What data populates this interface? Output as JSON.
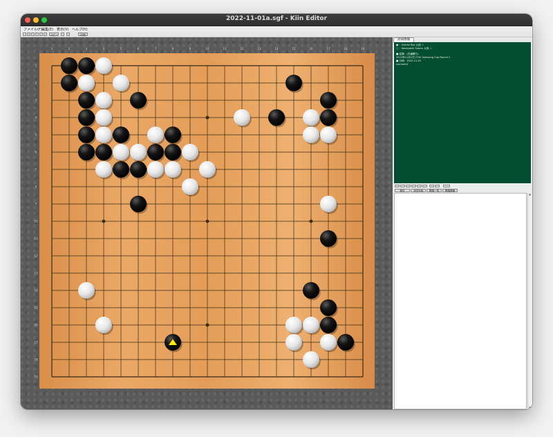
{
  "window": {
    "title": "2022-11-01a.sgf - Kiin Editor"
  },
  "menu": {
    "items": [
      "ファイル(F)",
      "編集(E)",
      "表示(V)",
      "ヘルプ(H)"
    ]
  },
  "toolbar": {
    "labels": [
      "コピー",
      "印刷"
    ]
  },
  "sidepanel": {
    "tab_label": "対局情報",
    "info_rows": [
      "● ：Ichiriki Ryo                 九段 ☆",
      "○ ：Kobayashi Satoru            九段 ☆",
      "■ 結果：(白番勝ち)",
      "2022年11月1日 27th Samsung Cup Round 1",
      "■ 日時：2022-11-01",
      "comment"
    ],
    "nav_buttons": [
      "検討",
      "次回対局",
      "棋譜一覧",
      "棋譜情報"
    ]
  },
  "board": {
    "size": 19,
    "col_labels": [
      "1",
      "2",
      "3",
      "4",
      "5",
      "6",
      "7",
      "8",
      "9",
      "10",
      "11",
      "12",
      "13",
      "14",
      "15",
      "16",
      "17",
      "18",
      "19"
    ],
    "row_labels": [
      "1",
      "2",
      "3",
      "4",
      "5",
      "6",
      "7",
      "8",
      "9",
      "10",
      "11",
      "12",
      "13",
      "14",
      "15",
      "16",
      "17",
      "18",
      "19"
    ],
    "colors": {
      "wood": "#e0a060",
      "line": "#3a2a14",
      "black": "#111111",
      "white": "#f4f4f4",
      "marker": "#ffee00"
    },
    "stones": [
      {
        "c": "B",
        "x": 1,
        "y": 0
      },
      {
        "c": "B",
        "x": 2,
        "y": 0
      },
      {
        "c": "W",
        "x": 3,
        "y": 0
      },
      {
        "c": "B",
        "x": 1,
        "y": 1
      },
      {
        "c": "W",
        "x": 2,
        "y": 1
      },
      {
        "c": "W",
        "x": 4,
        "y": 1
      },
      {
        "c": "B",
        "x": 14,
        "y": 1
      },
      {
        "c": "B",
        "x": 2,
        "y": 2
      },
      {
        "c": "W",
        "x": 3,
        "y": 2
      },
      {
        "c": "B",
        "x": 5,
        "y": 2
      },
      {
        "c": "B",
        "x": 16,
        "y": 2
      },
      {
        "c": "B",
        "x": 2,
        "y": 3
      },
      {
        "c": "W",
        "x": 3,
        "y": 3
      },
      {
        "c": "W",
        "x": 11,
        "y": 3
      },
      {
        "c": "B",
        "x": 13,
        "y": 3
      },
      {
        "c": "W",
        "x": 15,
        "y": 3
      },
      {
        "c": "B",
        "x": 16,
        "y": 3
      },
      {
        "c": "B",
        "x": 2,
        "y": 4
      },
      {
        "c": "W",
        "x": 3,
        "y": 4
      },
      {
        "c": "B",
        "x": 4,
        "y": 4
      },
      {
        "c": "W",
        "x": 6,
        "y": 4
      },
      {
        "c": "B",
        "x": 7,
        "y": 4
      },
      {
        "c": "W",
        "x": 15,
        "y": 4
      },
      {
        "c": "W",
        "x": 16,
        "y": 4
      },
      {
        "c": "B",
        "x": 2,
        "y": 5
      },
      {
        "c": "B",
        "x": 3,
        "y": 5
      },
      {
        "c": "W",
        "x": 4,
        "y": 5
      },
      {
        "c": "W",
        "x": 5,
        "y": 5
      },
      {
        "c": "B",
        "x": 6,
        "y": 5
      },
      {
        "c": "B",
        "x": 7,
        "y": 5
      },
      {
        "c": "W",
        "x": 8,
        "y": 5
      },
      {
        "c": "W",
        "x": 3,
        "y": 6
      },
      {
        "c": "B",
        "x": 4,
        "y": 6
      },
      {
        "c": "B",
        "x": 5,
        "y": 6
      },
      {
        "c": "W",
        "x": 6,
        "y": 6
      },
      {
        "c": "W",
        "x": 7,
        "y": 6
      },
      {
        "c": "W",
        "x": 9,
        "y": 6
      },
      {
        "c": "W",
        "x": 8,
        "y": 7
      },
      {
        "c": "B",
        "x": 5,
        "y": 8
      },
      {
        "c": "W",
        "x": 16,
        "y": 8
      },
      {
        "c": "B",
        "x": 16,
        "y": 10
      },
      {
        "c": "W",
        "x": 2,
        "y": 13
      },
      {
        "c": "B",
        "x": 15,
        "y": 13
      },
      {
        "c": "B",
        "x": 16,
        "y": 14
      },
      {
        "c": "W",
        "x": 3,
        "y": 15
      },
      {
        "c": "W",
        "x": 14,
        "y": 15
      },
      {
        "c": "W",
        "x": 15,
        "y": 15
      },
      {
        "c": "B",
        "x": 16,
        "y": 15
      },
      {
        "c": "B",
        "x": 7,
        "y": 16,
        "last": true
      },
      {
        "c": "W",
        "x": 14,
        "y": 16
      },
      {
        "c": "W",
        "x": 16,
        "y": 16
      },
      {
        "c": "B",
        "x": 17,
        "y": 16
      },
      {
        "c": "W",
        "x": 15,
        "y": 17
      }
    ]
  }
}
